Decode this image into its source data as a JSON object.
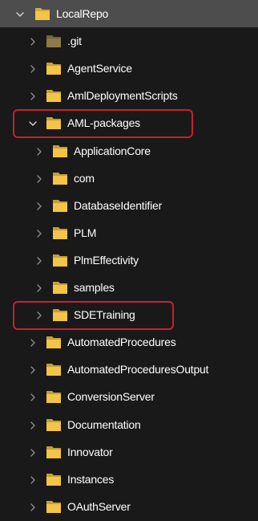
{
  "tree": {
    "items": [
      {
        "label": "LocalRepo",
        "level": 0,
        "expanded": true,
        "selected": true,
        "icon": "folder-icon",
        "highlighted": false
      },
      {
        "label": ".git",
        "level": 1,
        "expanded": false,
        "selected": false,
        "icon": "folder-dim-icon",
        "highlighted": false
      },
      {
        "label": "AgentService",
        "level": 1,
        "expanded": false,
        "selected": false,
        "icon": "folder-icon",
        "highlighted": false
      },
      {
        "label": "AmlDeploymentScripts",
        "level": 1,
        "expanded": false,
        "selected": false,
        "icon": "folder-icon",
        "highlighted": false
      },
      {
        "label": "AML-packages",
        "level": 1,
        "expanded": true,
        "selected": false,
        "icon": "folder-icon",
        "highlighted": true
      },
      {
        "label": "ApplicationCore",
        "level": 2,
        "expanded": false,
        "selected": false,
        "icon": "folder-icon",
        "highlighted": false
      },
      {
        "label": "com",
        "level": 2,
        "expanded": false,
        "selected": false,
        "icon": "folder-icon",
        "highlighted": false
      },
      {
        "label": "DatabaseIdentifier",
        "level": 2,
        "expanded": false,
        "selected": false,
        "icon": "folder-icon",
        "highlighted": false
      },
      {
        "label": "PLM",
        "level": 2,
        "expanded": false,
        "selected": false,
        "icon": "folder-icon",
        "highlighted": false
      },
      {
        "label": "PlmEffectivity",
        "level": 2,
        "expanded": false,
        "selected": false,
        "icon": "folder-icon",
        "highlighted": false
      },
      {
        "label": "samples",
        "level": 2,
        "expanded": false,
        "selected": false,
        "icon": "folder-icon",
        "highlighted": false
      },
      {
        "label": "SDETraining",
        "level": 2,
        "expanded": false,
        "selected": false,
        "icon": "folder-icon",
        "highlighted": true
      },
      {
        "label": "AutomatedProcedures",
        "level": 1,
        "expanded": false,
        "selected": false,
        "icon": "folder-icon",
        "highlighted": false
      },
      {
        "label": "AutomatedProceduresOutput",
        "level": 1,
        "expanded": false,
        "selected": false,
        "icon": "folder-icon",
        "highlighted": false
      },
      {
        "label": "ConversionServer",
        "level": 1,
        "expanded": false,
        "selected": false,
        "icon": "folder-icon",
        "highlighted": false
      },
      {
        "label": "Documentation",
        "level": 1,
        "expanded": false,
        "selected": false,
        "icon": "folder-icon",
        "highlighted": false
      },
      {
        "label": "Innovator",
        "level": 1,
        "expanded": false,
        "selected": false,
        "icon": "folder-icon",
        "highlighted": false
      },
      {
        "label": "Instances",
        "level": 1,
        "expanded": false,
        "selected": false,
        "icon": "folder-icon",
        "highlighted": false
      },
      {
        "label": "OAuthServer",
        "level": 1,
        "expanded": false,
        "selected": false,
        "icon": "folder-icon",
        "highlighted": false
      }
    ]
  },
  "colors": {
    "background": "#191919",
    "selected_row": "#4d4d4d",
    "folder": "#f3c445",
    "folder_dim": "#8c7a4a",
    "chevron": "#8a8a8a",
    "chevron_expanded": "#d8d8d8",
    "highlight": "#c8202e",
    "text": "#ffffff"
  }
}
